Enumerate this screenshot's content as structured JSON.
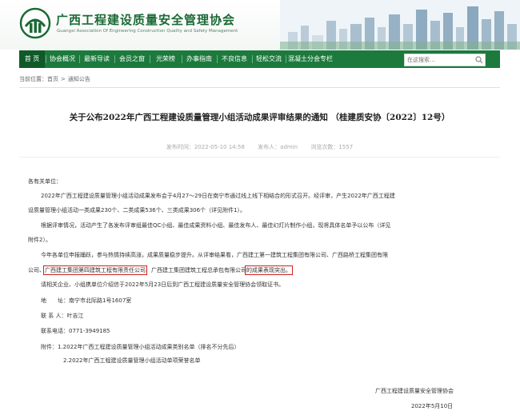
{
  "header": {
    "logo_title": "广西工程建设质量安全管理协会",
    "logo_subtitle": "Guangxi Association Of Engineering Construction Quality and Safety Management"
  },
  "nav": {
    "items": [
      "首 页",
      "协会概况",
      "最新导读",
      "会员之窗",
      "光荣榜",
      "办事指南",
      "不良信息",
      "轻松交流",
      "混凝土分会专栏"
    ],
    "active_index": 0
  },
  "search": {
    "placeholder": "在这搜索..."
  },
  "breadcrumb": {
    "label": "当前位置：",
    "items": [
      "首页",
      "通知公告"
    ],
    "separator": ">"
  },
  "article": {
    "title": "关于公布2022年广西工程建设质量管理小组活动成果评审结果的通知 （桂建质安协〔2022〕12号）",
    "meta": {
      "published": "发布时间：2022-05-10 14:58",
      "publisher": "发布人：admin",
      "views": "浏览次数：1557"
    },
    "salutation": "各有关单位：",
    "p1_line1": "2022年广西工程建设质量管理小组活动成果发布会于4月27～29日在南宁市通过线上线下相结合的形式召开。经评审，产生2022年广西工程建",
    "p1_line2": "设质量管理小组活动一类成果230个、二类成果536个、三类成果306个（详见附件1）。",
    "p2_line1": "根据评审情况，活动产生了各发布评审组最佳QC小组、最佳成果资料小组、最佳发布人、最佳幻灯片制作小组，现将具体名单予以公布（详见",
    "p2_line2": "附件2）。",
    "p3_line1": "今年各单位申报踊跃，参与热情持续高涨，成果质量稳步提升。从评审结果看，广西建工第一建筑工程集团有限公司、广西路桥工程集团有限",
    "p3_l2_a": "公司、",
    "p3_l2_hl1": "广西建工集团第四建筑工程有限责任公司",
    "p3_l2_b": "、广西建工集团建筑工程总承包有限公司",
    "p3_l2_hl2": "的成果表现突出。",
    "p4": "请相关企业、小组携单位介绍信于2022年5月23日后到广西工程建设质量安全管理协会领取证书。",
    "address": "地　　址：南宁市北际路1号1607室",
    "contact": "联 系 人：叶吉江",
    "phone": "联系电话：0771-3949185",
    "attach1": "附件：1.2022年广西工程建设质量管理小组活动成果类别名单（排名不分先后）",
    "attach2": "2.2022年广西工程建设质量管理小组活动单项荣誉名单",
    "signature": "广西工程建设质量安全管理协会",
    "date": "2022年5月10日"
  },
  "colors": {
    "nav_bg": "#1c7a3c",
    "nav_active": "#0f5a28",
    "highlight_box": "#d32020",
    "logo_green": "#1b6a35"
  }
}
